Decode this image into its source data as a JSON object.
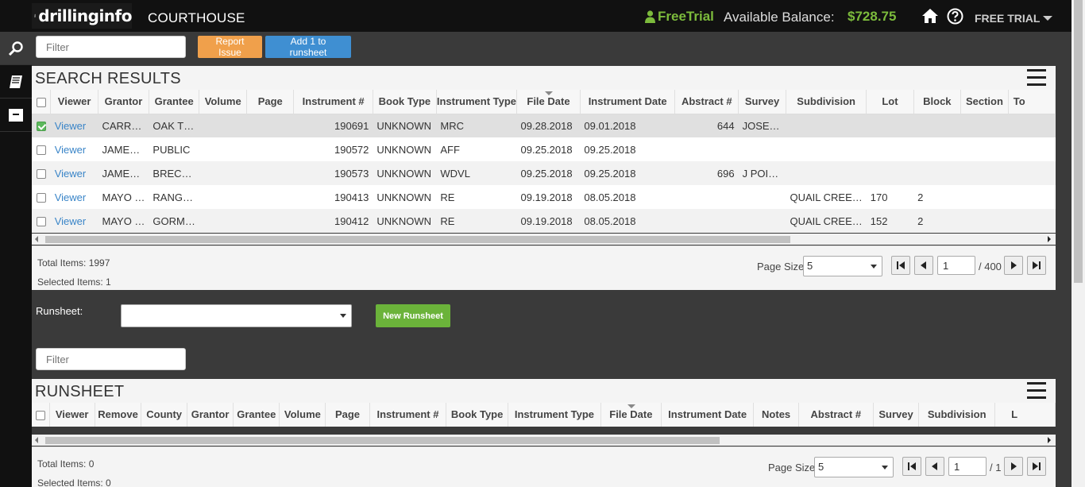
{
  "header": {
    "brand": "drillinginfo",
    "app_title": "COURTHOUSE",
    "free_trial": "FreeTrial",
    "balance_label": "Available Balance:",
    "balance_value": "$728.75",
    "trial_menu": "FREE TRIAL"
  },
  "sidebar": {
    "items": [
      {
        "icon": "search-icon"
      },
      {
        "icon": "book-icon"
      },
      {
        "icon": "inbox-icon"
      }
    ]
  },
  "toolbar": {
    "filter_placeholder": "Filter",
    "report_issue": "Report Issue",
    "add_to_runsheet": "Add 1 to runsheet"
  },
  "search_results": {
    "title": "SEARCH RESULTS",
    "columns": [
      "Viewer",
      "Grantor",
      "Grantee",
      "Volume",
      "Page",
      "Instrument #",
      "Book Type",
      "Instrument Type",
      "File Date",
      "Instrument Date",
      "Abstract #",
      "Survey",
      "Subdivision",
      "Lot",
      "Block",
      "Section",
      "To"
    ],
    "rows": [
      {
        "selected": true,
        "viewer": "Viewer",
        "grantor": "CARR…",
        "grantee": "OAK T…",
        "volume": "",
        "page": "",
        "instrument": "190691",
        "book_type": "UNKNOWN",
        "instrument_type": "MRC",
        "file_date": "09.28.2018",
        "instrument_date": "09.01.2018",
        "abstract": "644",
        "survey": "JOSE…",
        "subdivision": "",
        "lot": "",
        "block": "",
        "section": ""
      },
      {
        "selected": false,
        "viewer": "Viewer",
        "grantor": "JAME…",
        "grantee": "PUBLIC",
        "volume": "",
        "page": "",
        "instrument": "190572",
        "book_type": "UNKNOWN",
        "instrument_type": "AFF",
        "file_date": "09.25.2018",
        "instrument_date": "09.25.2018",
        "abstract": "",
        "survey": "",
        "subdivision": "",
        "lot": "",
        "block": "",
        "section": ""
      },
      {
        "selected": false,
        "viewer": "Viewer",
        "grantor": "JAME…",
        "grantee": "BREC…",
        "volume": "",
        "page": "",
        "instrument": "190573",
        "book_type": "UNKNOWN",
        "instrument_type": "WDVL",
        "file_date": "09.25.2018",
        "instrument_date": "09.25.2018",
        "abstract": "696",
        "survey": "J POI…",
        "subdivision": "",
        "lot": "",
        "block": "",
        "section": ""
      },
      {
        "selected": false,
        "viewer": "Viewer",
        "grantor": "MAYO …",
        "grantee": "RANG…",
        "volume": "",
        "page": "",
        "instrument": "190413",
        "book_type": "UNKNOWN",
        "instrument_type": "RE",
        "file_date": "09.19.2018",
        "instrument_date": "08.05.2018",
        "abstract": "",
        "survey": "",
        "subdivision": "QUAIL CREE…",
        "lot": "170",
        "block": "2",
        "section": ""
      },
      {
        "selected": false,
        "viewer": "Viewer",
        "grantor": "MAYO …",
        "grantee": "GORM…",
        "volume": "",
        "page": "",
        "instrument": "190412",
        "book_type": "UNKNOWN",
        "instrument_type": "RE",
        "file_date": "09.19.2018",
        "instrument_date": "08.05.2018",
        "abstract": "",
        "survey": "",
        "subdivision": "QUAIL CREE…",
        "lot": "152",
        "block": "2",
        "section": ""
      }
    ],
    "total_items": "Total Items: 1997",
    "selected_items": "Selected Items: 1",
    "page_size_label": "Page Size:",
    "page_size": "5",
    "page": "1",
    "page_total": "/ 400"
  },
  "runsheet_bar": {
    "label": "Runsheet:",
    "select_value": "",
    "new_runsheet": "New Runsheet",
    "filter_placeholder": "Filter"
  },
  "runsheet": {
    "title": "RUNSHEET",
    "columns": [
      "Viewer",
      "Remove",
      "County",
      "Grantor",
      "Grantee",
      "Volume",
      "Page",
      "Instrument #",
      "Book Type",
      "Instrument Type",
      "File Date",
      "Instrument Date",
      "Notes",
      "Abstract #",
      "Survey",
      "Subdivision",
      "L"
    ],
    "total_items": "Total Items: 0",
    "selected_items": "Selected Items: 0",
    "page_size_label": "Page Size:",
    "page_size": "5",
    "page": "1",
    "page_total": "/ 1"
  },
  "colors": {
    "accent_green": "#7cbb3c",
    "link_blue": "#3a85c8",
    "button_orange": "#f0a04b",
    "button_blue": "#3f8fd2"
  }
}
